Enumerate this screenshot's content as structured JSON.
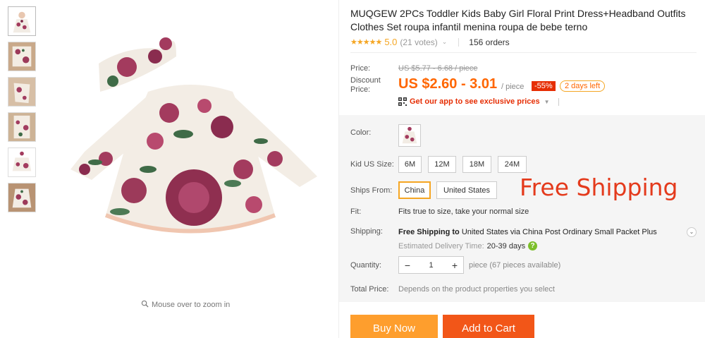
{
  "product": {
    "title": "MUQGEW 2PCs Toddler Kids Baby Girl Floral Print Dress+Headband Outfits Clothes Set roupa infantil menina roupa de bebe terno",
    "rating": {
      "stars": "★★★★★",
      "score": "5.0",
      "votes": "(21 votes)",
      "orders": "156 orders"
    }
  },
  "pricing": {
    "price_label": "Price:",
    "original": "US $5.77 - 6.68 / piece",
    "discount_label": "Discount Price:",
    "discount_price": "US $2.60 - 3.01",
    "per": "/ piece",
    "percent_off": "-55%",
    "days_left": "2 days left",
    "app_promo": "Get our app to see exclusive prices"
  },
  "options": {
    "color_label": "Color:",
    "size_label": "Kid US Size:",
    "sizes": [
      "6M",
      "12M",
      "18M",
      "24M"
    ],
    "ships_from_label": "Ships From:",
    "ships_from": [
      "China",
      "United States"
    ],
    "selected_ship": "China",
    "free_shipping_banner": "Free Shipping",
    "fit_label": "Fit:",
    "fit_value": "Fits true to size, take your normal size",
    "shipping_label": "Shipping:",
    "shipping_free": "Free Shipping to",
    "shipping_detail": " United States via China Post Ordinary Small Packet Plus",
    "eta_label": "Estimated Delivery Time:",
    "eta_days": "20-39 days",
    "quantity_label": "Quantity:",
    "quantity": "1",
    "quantity_available": "piece (67 pieces available)",
    "total_label": "Total Price:",
    "total_value": "Depends on the product properties you select"
  },
  "actions": {
    "buy_now": "Buy Now",
    "add_to_cart": "Add to Cart"
  },
  "gallery": {
    "zoom_hint": "Mouse over to zoom in"
  },
  "colors": {
    "accent": "#ff6600",
    "buy": "#fe9e2d",
    "cart": "#f25618",
    "badge": "#e62e04"
  }
}
